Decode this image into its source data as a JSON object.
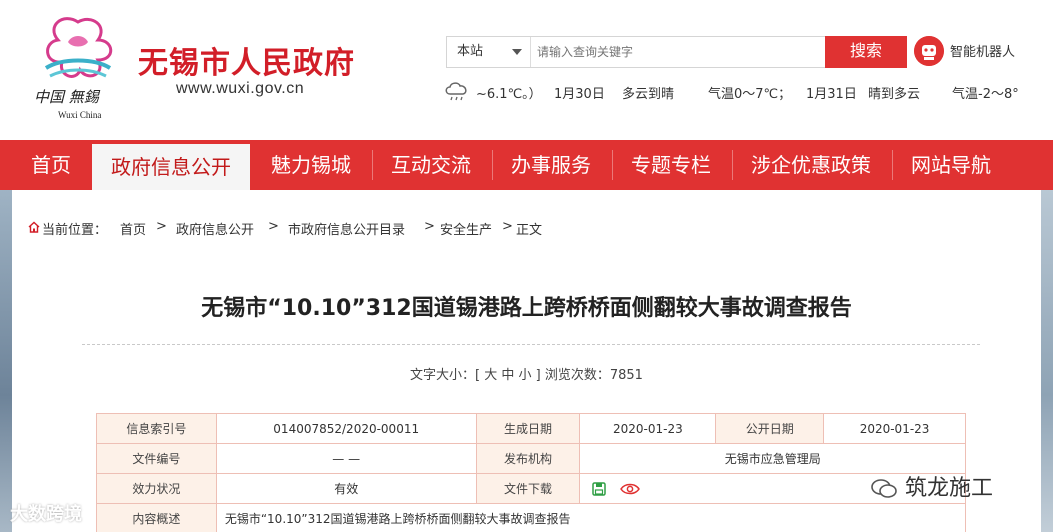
{
  "header": {
    "site_title": "无锡市人民政府",
    "site_url": "www.wuxi.gov.cn",
    "logo_cn": "中国 無錫",
    "logo_en": "Wuxi China",
    "search": {
      "scope": "本站",
      "placeholder": "请输入查询关键字",
      "button": "搜索"
    },
    "robot_label": "智能机器人",
    "weather": {
      "current": "~6.1℃。）",
      "d1_date": "1月30日",
      "d1_cond": "多云到晴",
      "d1_temp": "气温0～7℃；",
      "d2_date": "1月31日",
      "d2_cond": "晴到多云",
      "d2_temp": "气温-2～8°"
    }
  },
  "nav": {
    "items": [
      "首页",
      "政府信息公开",
      "魅力锡城",
      "互动交流",
      "办事服务",
      "专题专栏",
      "涉企优惠政策",
      "网站导航"
    ],
    "active": 1
  },
  "breadcrumb": {
    "prefix": "当前位置：",
    "items": [
      "首页",
      "政府信息公开",
      "市政府信息公开目录",
      "安全生产",
      "正文"
    ],
    "sep": ">"
  },
  "article": {
    "title": "无锡市“10.10”312国道锡港路上跨桥桥面侧翻较大事故调查报告",
    "meta": "文字大小：[ 大 中 小 ]   浏览次数：7851"
  },
  "info_table": {
    "row1": [
      "信息索引号",
      "014007852/2020-00011",
      "生成日期",
      "2020-01-23",
      "公开日期",
      "2020-01-23"
    ],
    "row2": [
      "文件编号",
      "— —",
      "发布机构",
      "无锡市应急管理局"
    ],
    "row3": [
      "效力状况",
      "有效",
      "文件下载"
    ],
    "row4": [
      "内容概述",
      "无锡市“10.10”312国道锡港路上跨桥桥面侧翻较大事故调查报告"
    ]
  },
  "watermarks": {
    "left": "大数跨境",
    "right": "筑龙施工"
  },
  "colors": {
    "brand_red": "#e03232",
    "title_red": "#d21e28",
    "table_border": "#eebfb5",
    "label_bg": "#fdf1e8"
  }
}
